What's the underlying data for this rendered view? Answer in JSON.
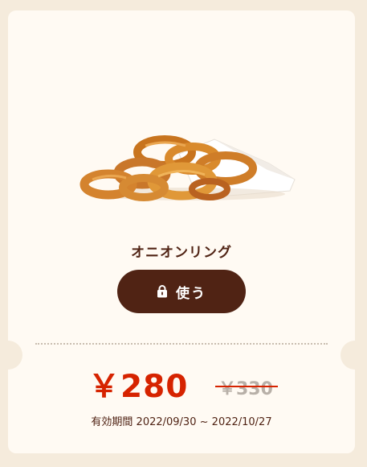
{
  "coupon": {
    "product_name": "オニオンリング",
    "use_button_label": "使う",
    "price": "￥280",
    "original_price": "￥330",
    "validity_label": "有効期間",
    "validity_start": "2022/09/30",
    "validity_separator": "~",
    "validity_end": "2022/10/27"
  },
  "icons": {
    "use_button_icon": "lock-icon"
  },
  "colors": {
    "background": "#f5ebdc",
    "card": "#fffaf3",
    "brand_brown": "#502314",
    "price_red": "#d62300",
    "old_price_gray": "#b8b0a8"
  }
}
